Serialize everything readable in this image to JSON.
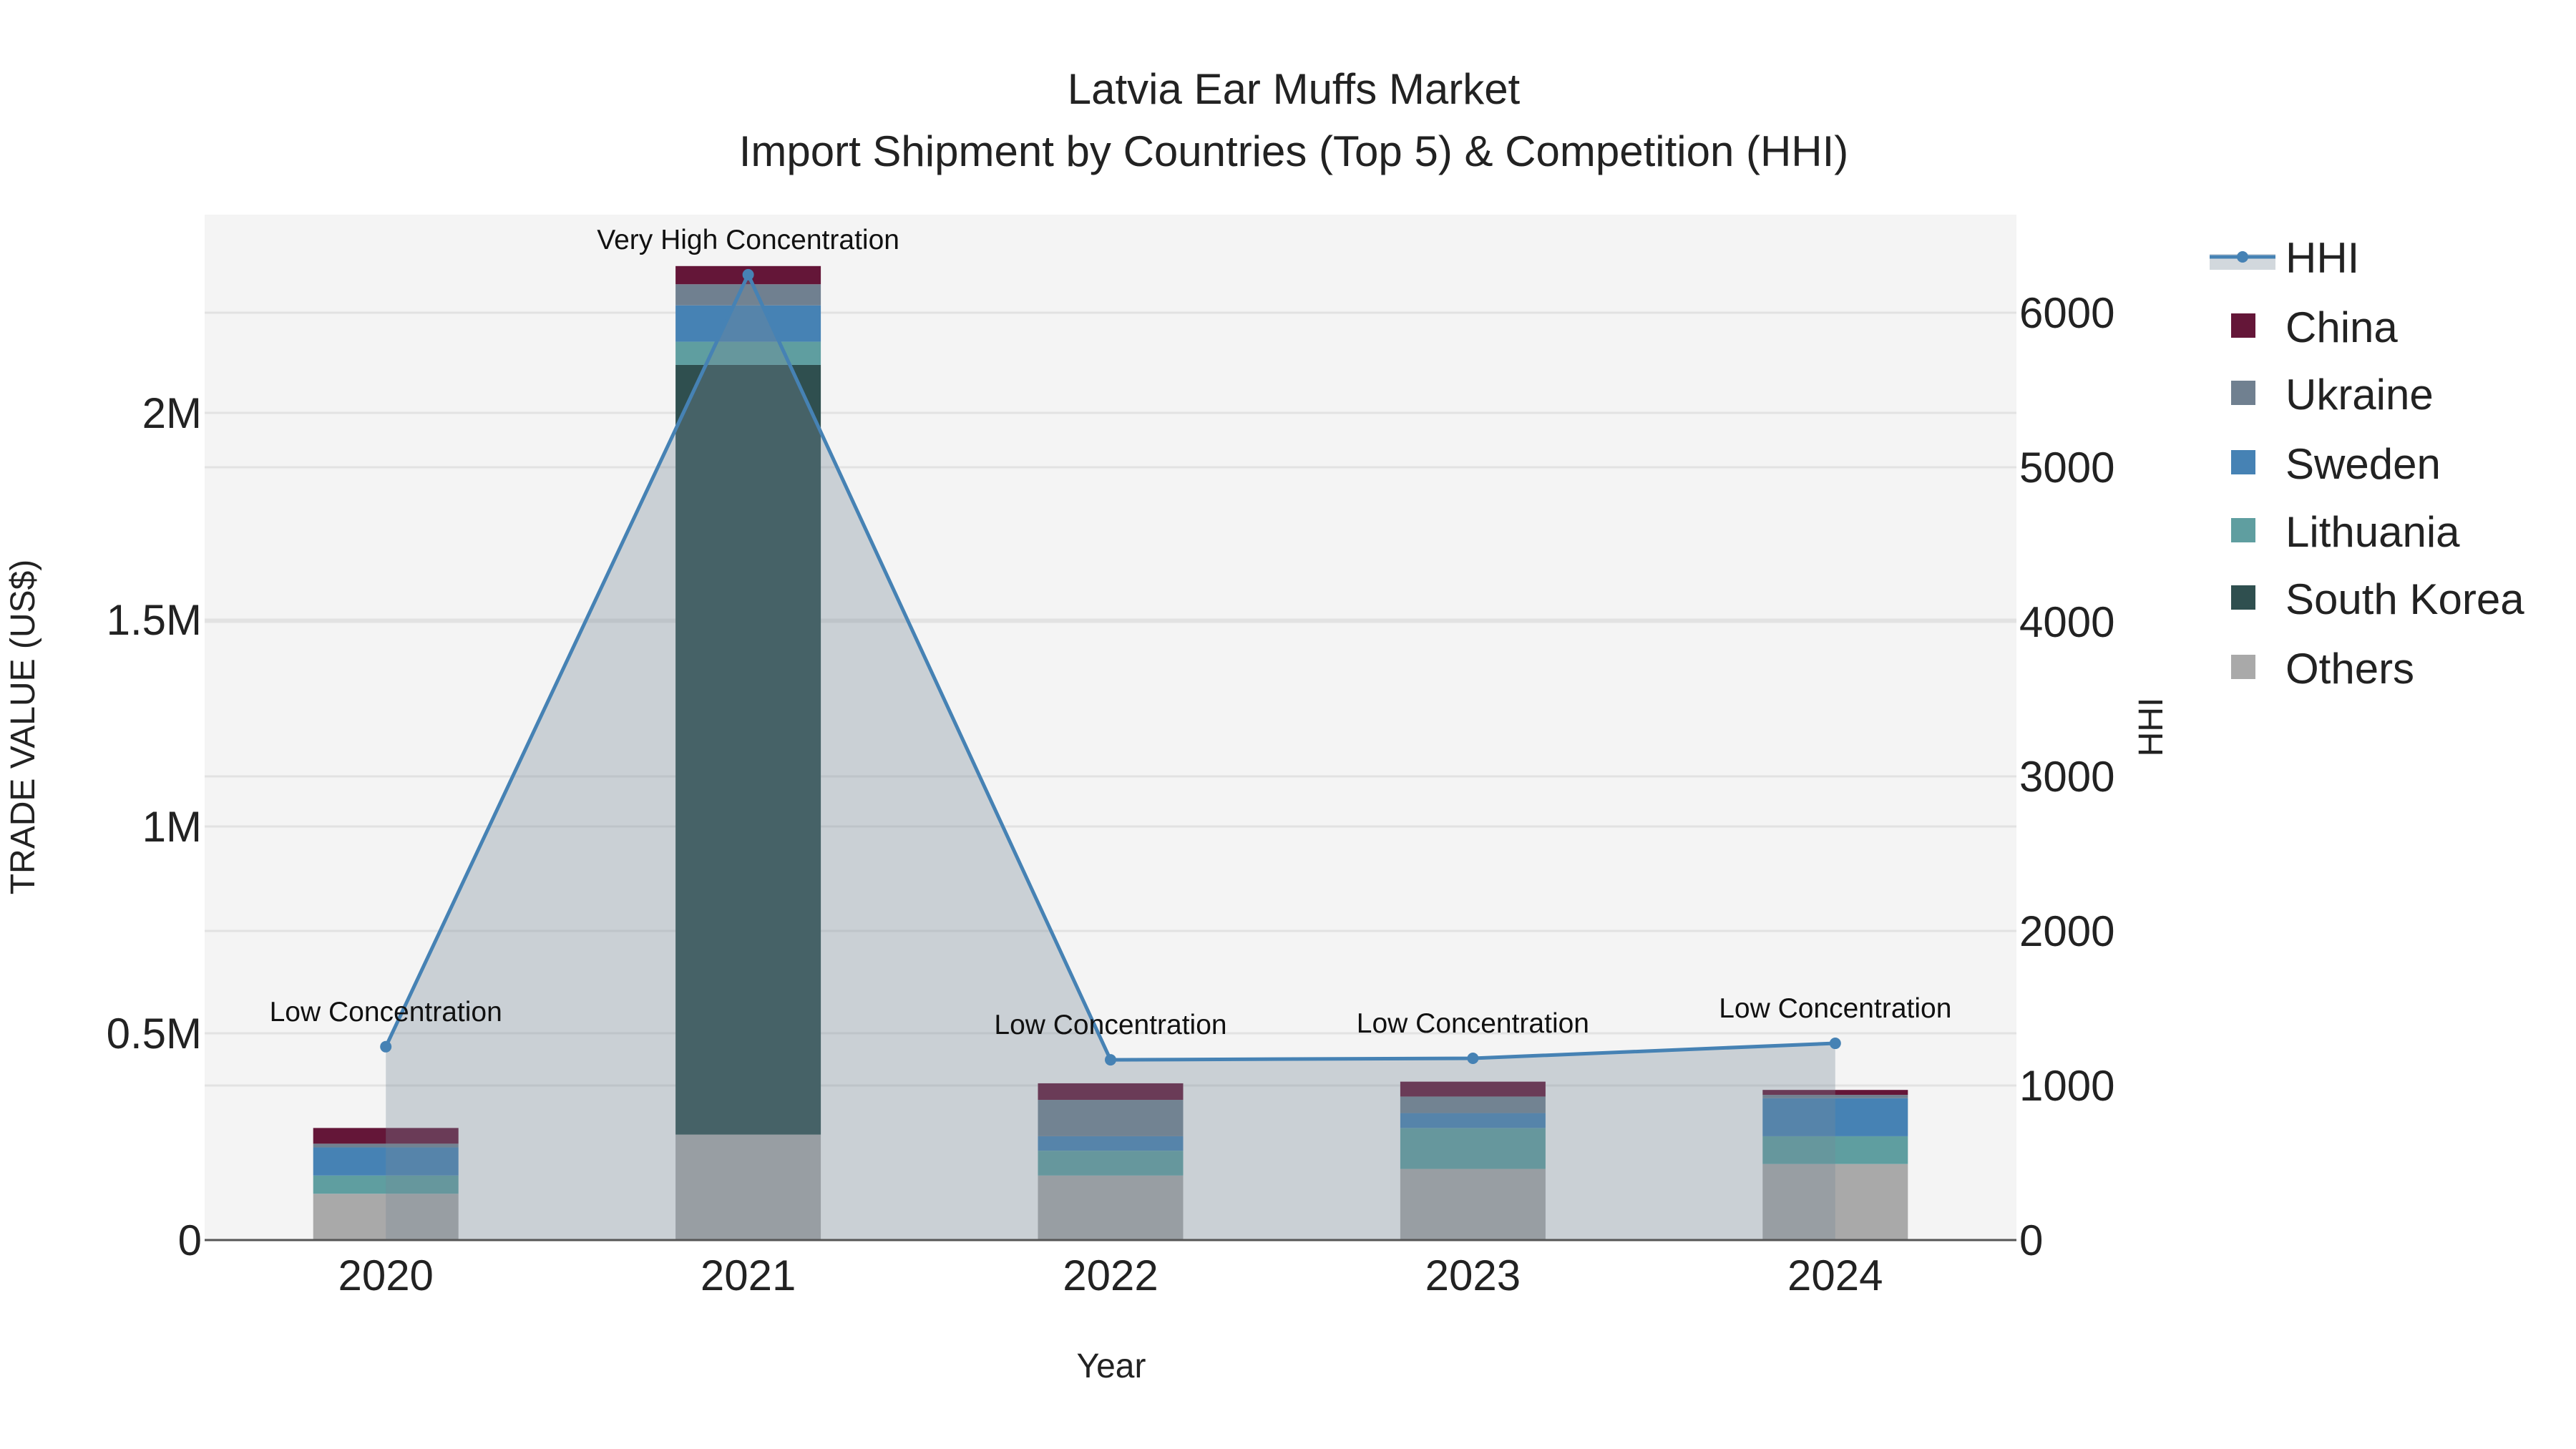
{
  "chart_data": {
    "type": "bar",
    "title": "Latvia Ear Muffs Market",
    "subtitle": "Import Shipment by Countries (Top 5) & Competition (HHI)",
    "xlabel": "Year",
    "ylabel": "TRADE VALUE (US$)",
    "y2label": "HHI",
    "categories": [
      "2020",
      "2021",
      "2022",
      "2023",
      "2024"
    ],
    "ylim": [
      0,
      2400000
    ],
    "y2lim": [
      0,
      6650
    ],
    "yticks": [
      {
        "v": 0,
        "label": "0"
      },
      {
        "v": 500000,
        "label": "0.5M"
      },
      {
        "v": 1000000,
        "label": "1M"
      },
      {
        "v": 1500000,
        "label": "1.5M"
      },
      {
        "v": 2000000,
        "label": "2M"
      }
    ],
    "y2ticks": [
      0,
      1000,
      2000,
      3000,
      4000,
      5000,
      6000
    ],
    "stacked": true,
    "grid": true,
    "legend_position": "right",
    "series": [
      {
        "name": "Others",
        "color": "#A9A9A9",
        "values": [
          112000,
          255000,
          156000,
          172000,
          184000
        ]
      },
      {
        "name": "South Korea",
        "color": "#2F4F4F",
        "values": [
          0,
          1861000,
          0,
          0,
          0
        ]
      },
      {
        "name": "Lithuania",
        "color": "#5F9EA0",
        "values": [
          44000,
          56000,
          60000,
          99000,
          67000
        ]
      },
      {
        "name": "Sweden",
        "color": "#4682B4",
        "values": [
          68000,
          88000,
          35000,
          36000,
          92000
        ]
      },
      {
        "name": "Ukraine",
        "color": "#708090",
        "values": [
          9000,
          51000,
          88000,
          40000,
          8000
        ]
      },
      {
        "name": "China",
        "color": "#641638",
        "values": [
          38000,
          44000,
          40000,
          36000,
          12000
        ]
      }
    ],
    "hhi": {
      "name": "HHI",
      "color": "#4682B4",
      "values": [
        1251,
        6246,
        1166,
        1176,
        1273
      ],
      "annotations": [
        "Low Concentration",
        "Very High Concentration",
        "Low Concentration",
        "Low Concentration",
        "Low Concentration"
      ]
    },
    "legend": [
      "HHI",
      "China",
      "Ukraine",
      "Sweden",
      "Lithuania",
      "South Korea",
      "Others"
    ]
  }
}
